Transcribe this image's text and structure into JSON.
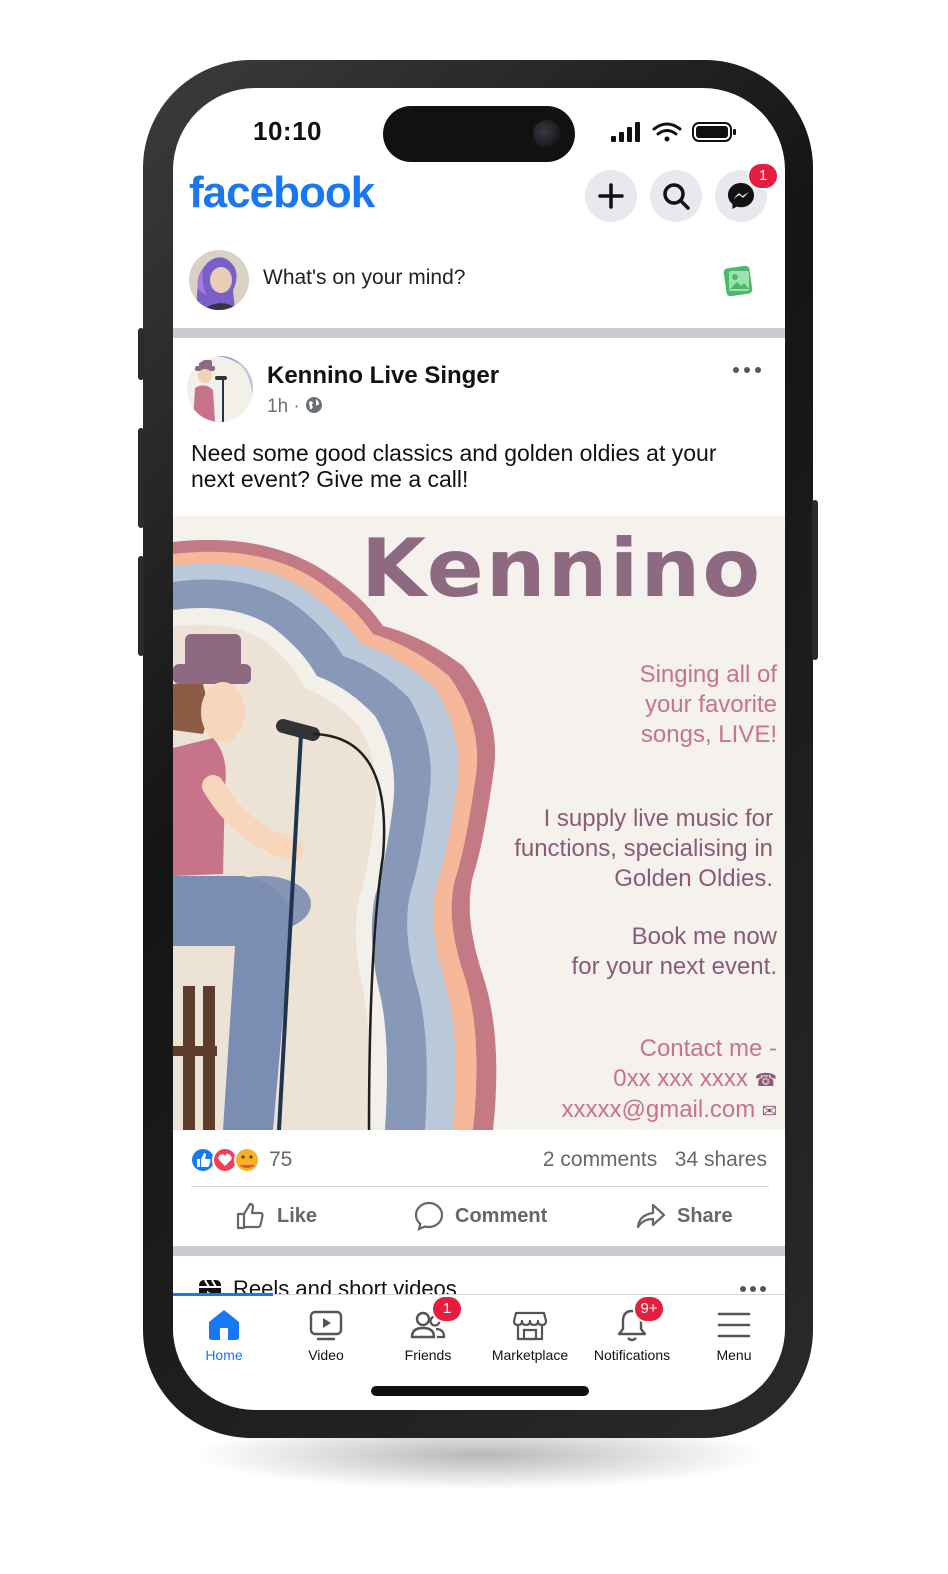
{
  "status": {
    "time": "10:10"
  },
  "header": {
    "logo": "facebook",
    "add_icon": "plus-icon",
    "search_icon": "search-icon",
    "messenger_icon": "messenger-icon",
    "messenger_badge": "1"
  },
  "composer": {
    "placeholder": "What's on your mind?",
    "photo_icon": "photo-icon"
  },
  "post": {
    "author": "Kennino Live Singer",
    "time": "1h",
    "audience_icon": "globe-icon",
    "text": "Need some good classics and golden oldies at your next event? Give me a call!",
    "image": {
      "title": "Kennino",
      "tagline": [
        "Singing all of",
        "your favorite",
        "songs, LIVE!"
      ],
      "description": [
        "I supply live music for",
        "functions, specialising in",
        "Golden Oldies."
      ],
      "cta": [
        "Book me now",
        "for your next event."
      ],
      "contact_heading": "Contact me -",
      "phone": "0xx xxx xxxx",
      "email": "xxxxx@gmail.com",
      "colors": {
        "title": "#8e6a82",
        "pink": "#c7748b",
        "mauve": "#8c5a79"
      }
    },
    "reactions_count": "75",
    "comments": "2 comments",
    "shares": "34 shares",
    "actions": {
      "like": "Like",
      "comment": "Comment",
      "share": "Share"
    }
  },
  "reels": {
    "title": "Reels and short videos"
  },
  "tabs": [
    {
      "label": "Home",
      "icon": "home-icon",
      "active": true
    },
    {
      "label": "Video",
      "icon": "video-icon"
    },
    {
      "label": "Friends",
      "icon": "friends-icon",
      "badge": "1"
    },
    {
      "label": "Marketplace",
      "icon": "marketplace-icon"
    },
    {
      "label": "Notifications",
      "icon": "bell-icon",
      "badge": "9+"
    },
    {
      "label": "Menu",
      "icon": "menu-icon"
    }
  ],
  "colors": {
    "brand": "#1877f2",
    "badge": "#e41e3f",
    "muted": "#65676b"
  }
}
